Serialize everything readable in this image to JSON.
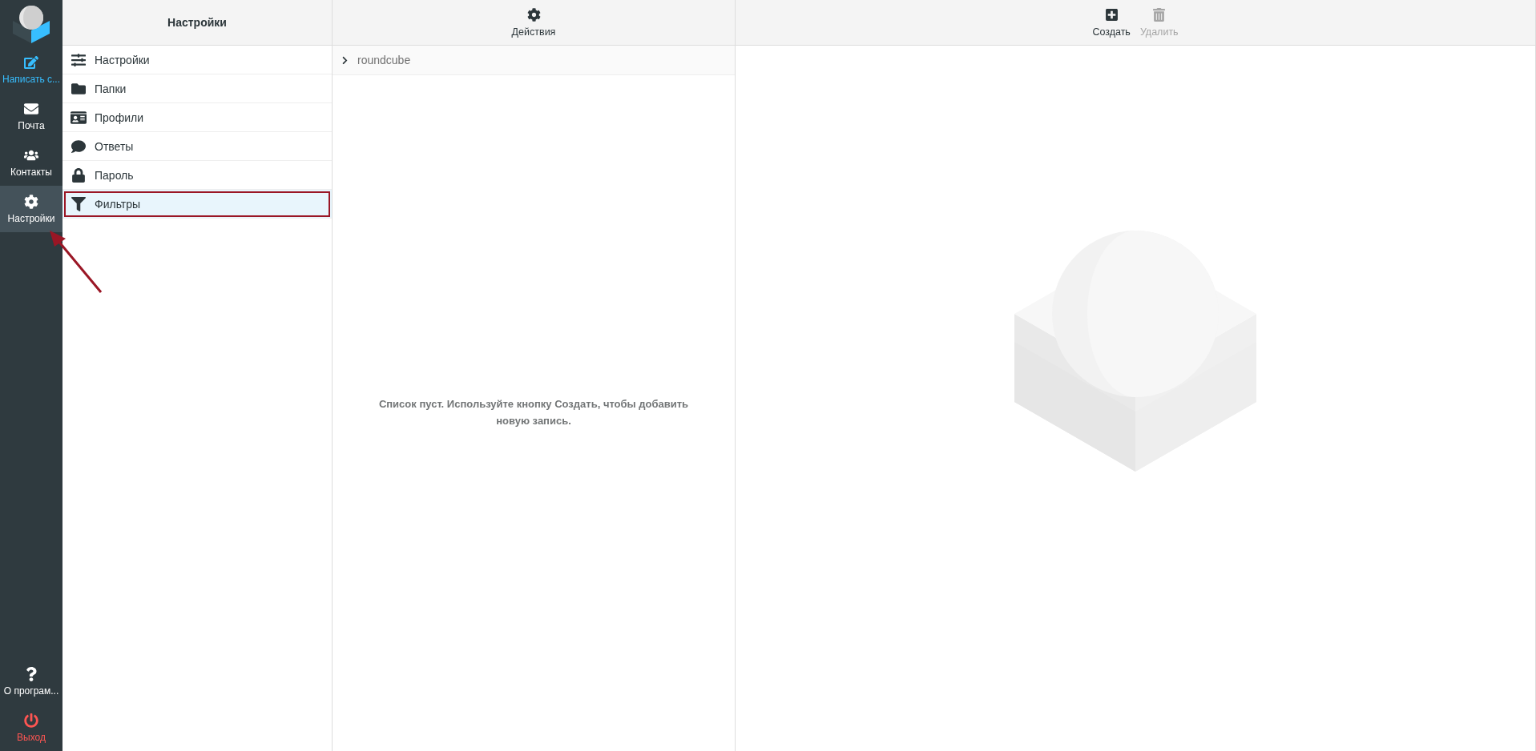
{
  "nav": {
    "top": [
      {
        "kind": "compose",
        "label": "Написать с...",
        "selected": false
      },
      {
        "kind": "mail",
        "label": "Почта",
        "selected": false
      },
      {
        "kind": "contacts",
        "label": "Контакты",
        "selected": false
      },
      {
        "kind": "settings",
        "label": "Настройки",
        "selected": true
      }
    ],
    "bottom": [
      {
        "kind": "about",
        "label": "О програм...",
        "selected": false
      },
      {
        "kind": "logout",
        "label": "Выход",
        "selected": false
      }
    ]
  },
  "settings_panel": {
    "title": "Настройки",
    "items": [
      {
        "kind": "prefs",
        "label": "Настройки",
        "selected": false,
        "annotated": false
      },
      {
        "kind": "folders",
        "label": "Папки",
        "selected": false,
        "annotated": false
      },
      {
        "kind": "identities",
        "label": "Профили",
        "selected": false,
        "annotated": false
      },
      {
        "kind": "responses",
        "label": "Ответы",
        "selected": false,
        "annotated": false
      },
      {
        "kind": "password",
        "label": "Пароль",
        "selected": false,
        "annotated": false
      },
      {
        "kind": "filters",
        "label": "Фильтры",
        "selected": true,
        "annotated": true
      }
    ]
  },
  "filter_sets": {
    "actions_label": "Действия",
    "items": [
      {
        "label": "roundcube",
        "expanded": false
      }
    ],
    "empty_message": "Список пуст. Используйте кнопку Создать, чтобы добавить новую запись."
  },
  "content": {
    "toolbar": [
      {
        "kind": "create",
        "label": "Создать",
        "disabled": false
      },
      {
        "kind": "delete",
        "label": "Удалить",
        "disabled": true
      }
    ]
  }
}
